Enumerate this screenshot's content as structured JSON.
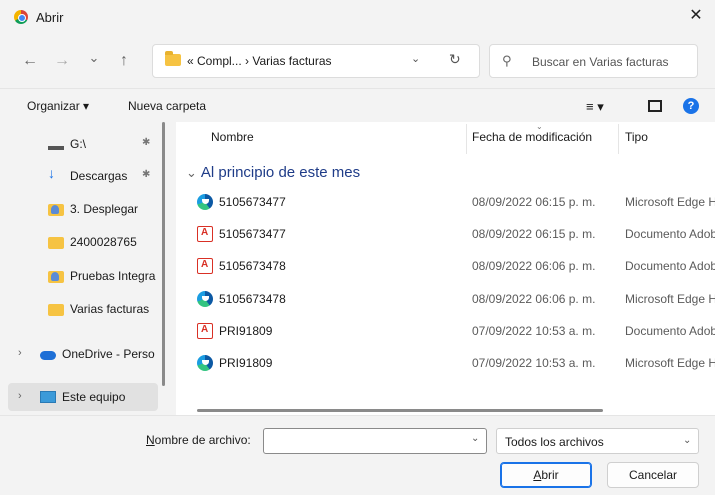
{
  "window": {
    "title": "Abrir",
    "close": "✕"
  },
  "nav": {
    "back": "←",
    "forward": "→",
    "recent": "⌄",
    "up": "↑",
    "address_crumbs": "« Compl...  ›  Varias facturas",
    "address_dropdown": "⌄",
    "refresh": "↻",
    "search_placeholder": "Buscar en Varias facturas"
  },
  "toolbar": {
    "organize": "Organizar ▾",
    "new_folder": "Nueva carpeta",
    "view": "≡ ▾",
    "help": "?"
  },
  "sidebar": {
    "items": [
      {
        "label": "G:\\",
        "icon": "drive-icon",
        "pinned": true
      },
      {
        "label": "Descargas",
        "icon": "download-icon",
        "pinned": true
      },
      {
        "label": "3. Desplegar",
        "icon": "folder-user-icon",
        "pinned": false
      },
      {
        "label": "2400028765",
        "icon": "folder-icon",
        "pinned": false
      },
      {
        "label": "Pruebas Integra",
        "icon": "folder-user-icon",
        "pinned": false
      },
      {
        "label": "Varias facturas",
        "icon": "folder-icon",
        "pinned": false
      },
      {
        "label": "OneDrive - Perso",
        "icon": "onedrive-icon",
        "chevron": "›"
      },
      {
        "label": "Este equipo",
        "icon": "pc-icon",
        "chevron": "›",
        "selected": true
      }
    ],
    "pin_glyph": "✱"
  },
  "columns": {
    "name": "Nombre",
    "date": "Fecha de modificación",
    "type": "Tipo",
    "sort_indicator": "⌄"
  },
  "group": {
    "arrow": "⌄",
    "label": "Al principio de este mes"
  },
  "files": [
    {
      "name": "5105673477",
      "date": "08/09/2022 06:15 p. m.",
      "type": "Microsoft Edge HTML",
      "icon": "edge-icon"
    },
    {
      "name": "5105673477",
      "date": "08/09/2022 06:15 p. m.",
      "type": "Documento Adobe",
      "icon": "pdf-icon"
    },
    {
      "name": "5105673478",
      "date": "08/09/2022 06:06 p. m.",
      "type": "Documento Adobe",
      "icon": "pdf-icon"
    },
    {
      "name": "5105673478",
      "date": "08/09/2022 06:06 p. m.",
      "type": "Microsoft Edge HTML",
      "icon": "edge-icon"
    },
    {
      "name": "PRI91809",
      "date": "07/09/2022 10:53 a. m.",
      "type": "Documento Adobe",
      "icon": "pdf-icon"
    },
    {
      "name": "PRI91809",
      "date": "07/09/2022 10:53 a. m.",
      "type": "Microsoft Edge HTML",
      "icon": "edge-icon"
    }
  ],
  "footer": {
    "filename_label_u": "N",
    "filename_label_rest": "ombre de archivo:",
    "filename_value": "",
    "filename_dropdown": "⌄",
    "filter_value": "Todos los archivos",
    "filter_dropdown": "⌄",
    "open_u": "A",
    "open_rest": "brir",
    "cancel": "Cancelar"
  }
}
